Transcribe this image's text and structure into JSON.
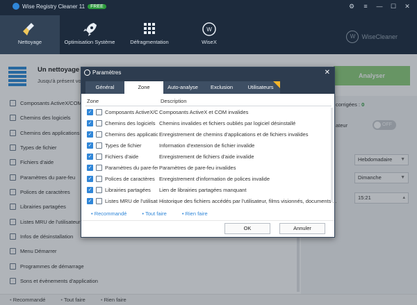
{
  "app": {
    "title": "Wise Registry Cleaner 11",
    "badge": "FREE",
    "brand": "WiseCleaner"
  },
  "window": {
    "minimize": "—",
    "maximize": "☐",
    "close": "✕",
    "settings": "⚙",
    "menu": "≡"
  },
  "nav": {
    "tabs": [
      {
        "label": "Nettoyage",
        "icon": "broom-icon"
      },
      {
        "label": "Optimisation Système",
        "icon": "rocket-icon"
      },
      {
        "label": "Défragmentation",
        "icon": "grid-icon"
      },
      {
        "label": "WiseX",
        "icon": "wisex-icon"
      }
    ]
  },
  "status": {
    "title": "Un nettoyage r",
    "subtitle": "Jusqu'à présent vou",
    "analyze": "Analyser"
  },
  "sidebar": {
    "items": [
      {
        "label": "Composants ActiveX/COM"
      },
      {
        "label": "Chemins des logiciels"
      },
      {
        "label": "Chemins des applications"
      },
      {
        "label": "Types de fichier"
      },
      {
        "label": "Fichiers d'aide"
      },
      {
        "label": "Paramètres du pare-feu"
      },
      {
        "label": "Polices de caractères"
      },
      {
        "label": "Librairies partagées"
      },
      {
        "label": "Listes MRU de l'utilisateur"
      },
      {
        "label": "Infos de désinstallation"
      },
      {
        "label": "Menu Démarrer"
      },
      {
        "label": "Programmes de démarrage"
      },
      {
        "label": "Sons et évènements d'application"
      }
    ]
  },
  "right": {
    "corrected_label": "corrigées :",
    "corrected_value": "0",
    "auto_label": "ateur",
    "toggle": "OFF",
    "frequency": "Hebdomadaire",
    "day": "Dimanche",
    "time": "15:21"
  },
  "bottom": {
    "links": [
      "Recommandé",
      "Tout faire",
      "Rien faire"
    ]
  },
  "dialog": {
    "title": "Paramètres",
    "close": "✕",
    "tabs": [
      "Général",
      "Zone",
      "Auto-analyse",
      "Exclusion",
      "Utilisateurs"
    ],
    "col_zone": "Zone",
    "col_desc": "Description",
    "rows": [
      {
        "zone": "Composants ActiveX/COM",
        "desc": "Composants ActiveX et COM invalides"
      },
      {
        "zone": "Chemins des logiciels",
        "desc": "Chemins invalides et fichiers oubliés par logiciel désinstallé"
      },
      {
        "zone": "Chemins des applications",
        "desc": "Enregistrement de chemins d'applications et de fichiers invalides"
      },
      {
        "zone": "Types de fichier",
        "desc": "Information d'extension de fichier invalide"
      },
      {
        "zone": "Fichiers d'aide",
        "desc": "Enregistrement de fichiers d'aide invalide"
      },
      {
        "zone": "Paramètres du pare-feu",
        "desc": "Paramètres de pare-feu invalides"
      },
      {
        "zone": "Polices de caractères",
        "desc": "Enregistrement d'information de polices invalide"
      },
      {
        "zone": "Librairies partagées",
        "desc": "Lien de librairies partagées manquant"
      },
      {
        "zone": "Listes MRU de l'utilisateur",
        "desc": "Historique des fichiers accédés par l'utilisateur, films visionnés, documents ..."
      }
    ],
    "links": [
      "Recommandé",
      "Tout faire",
      "Rien faire"
    ],
    "ok": "OK",
    "cancel": "Annuler"
  }
}
